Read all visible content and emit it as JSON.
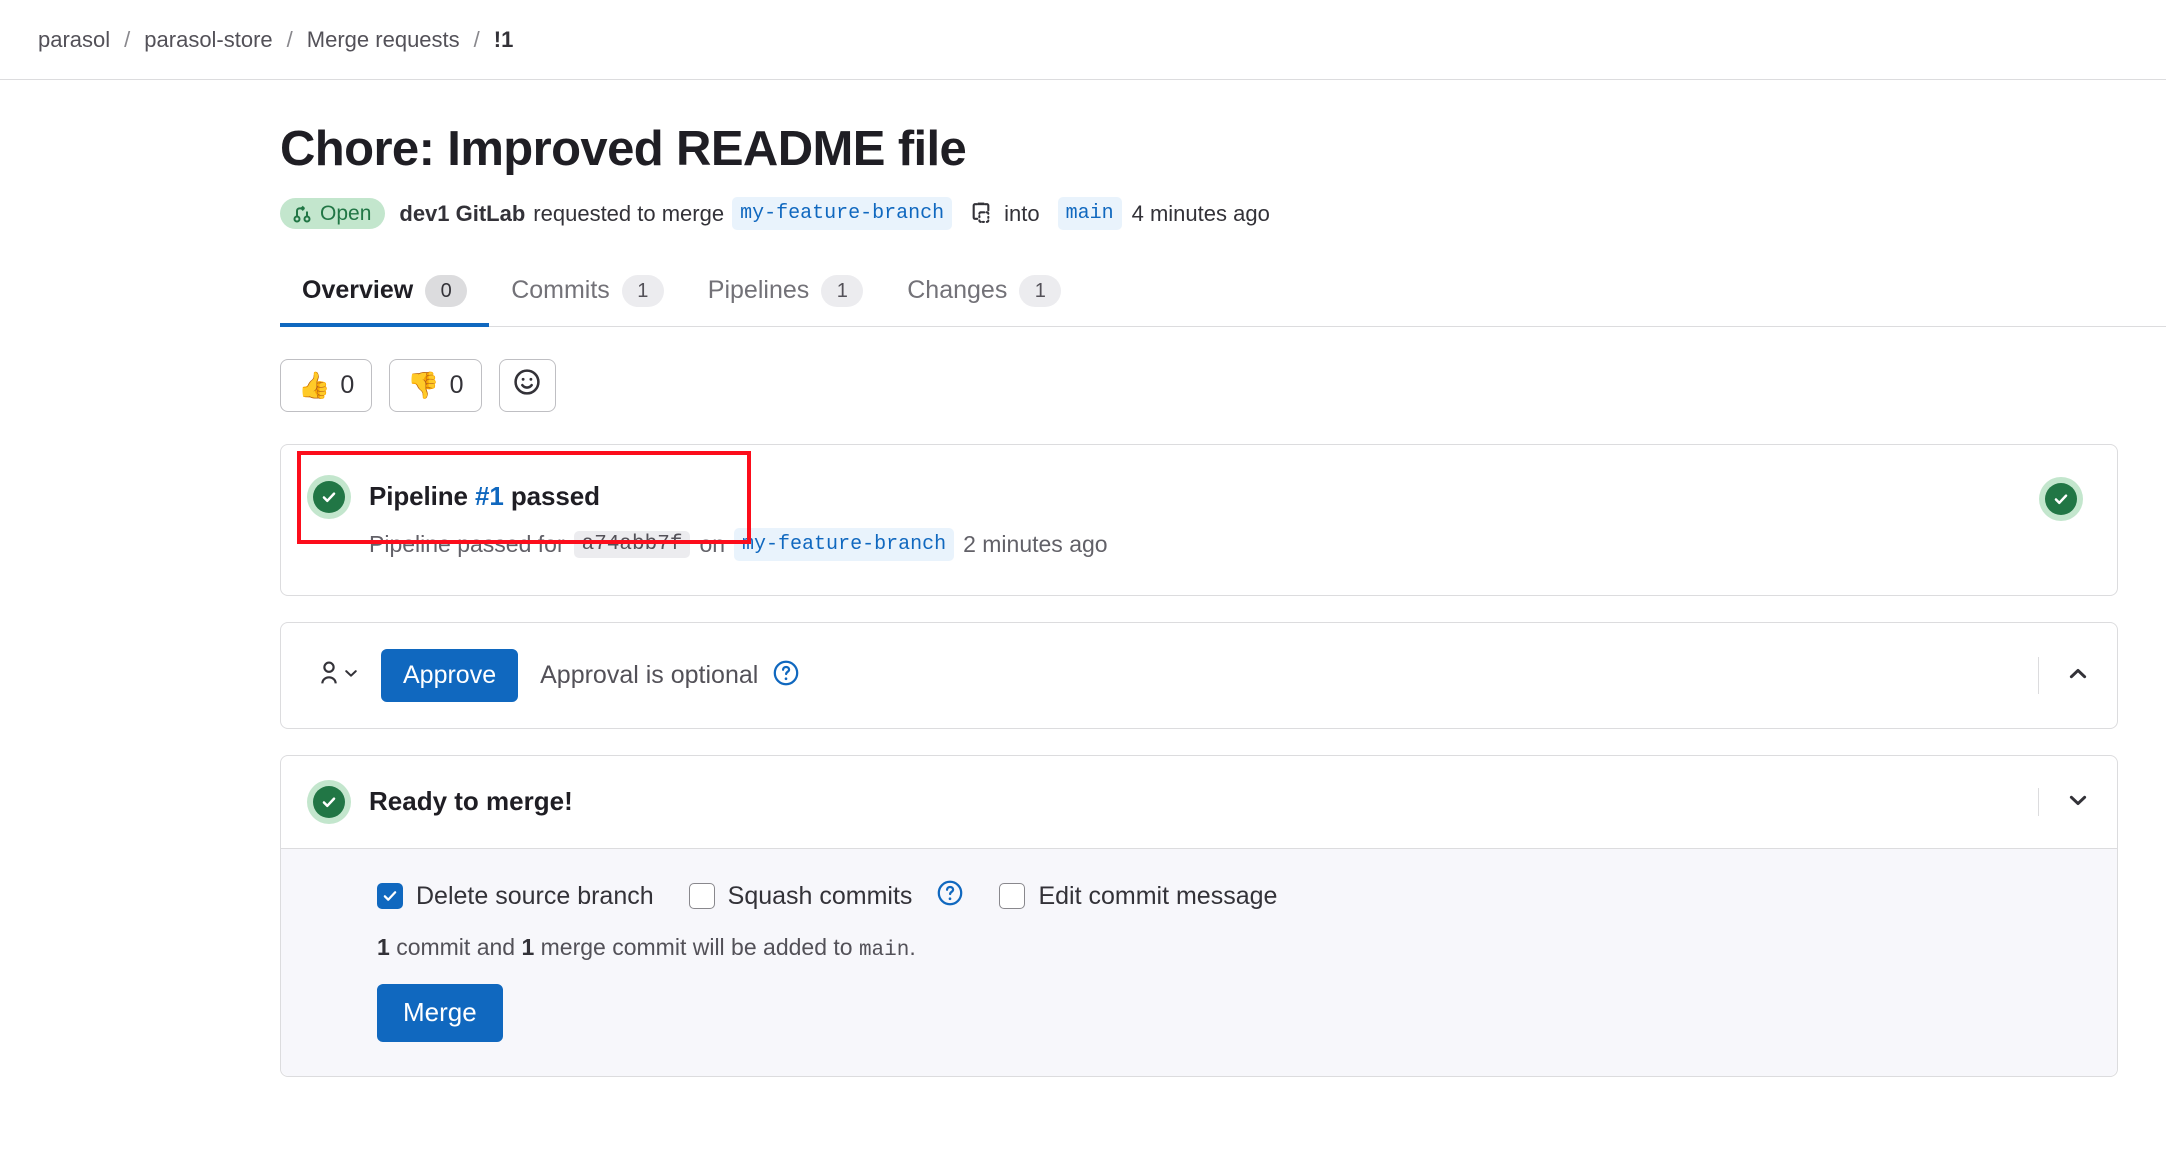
{
  "breadcrumb": {
    "items": [
      {
        "label": "parasol",
        "current": false
      },
      {
        "label": "parasol-store",
        "current": false
      },
      {
        "label": "Merge requests",
        "current": false
      },
      {
        "label": "!1",
        "current": true
      }
    ],
    "separator": "/"
  },
  "merge_request": {
    "title": "Chore: Improved README file",
    "status_badge": "Open",
    "author": "dev1 GitLab",
    "action_text": "requested to merge",
    "source_branch": "my-feature-branch",
    "into_text": "into",
    "target_branch": "main",
    "timestamp": "4 minutes ago"
  },
  "tabs": [
    {
      "label": "Overview",
      "count": "0",
      "active": true
    },
    {
      "label": "Commits",
      "count": "1",
      "active": false
    },
    {
      "label": "Pipelines",
      "count": "1",
      "active": false
    },
    {
      "label": "Changes",
      "count": "1",
      "active": false
    }
  ],
  "reactions": {
    "thumbs_up": {
      "emoji": "👍",
      "count": "0"
    },
    "thumbs_down": {
      "emoji": "👎",
      "count": "0"
    }
  },
  "pipeline": {
    "title_prefix": "Pipeline",
    "number": "#1",
    "title_suffix": "passed",
    "detail_prefix": "Pipeline passed for",
    "commit_sha": "a74abb7f",
    "on_text": "on",
    "branch": "my-feature-branch",
    "timestamp": "2 minutes ago"
  },
  "approval": {
    "button_label": "Approve",
    "status_text": "Approval is optional"
  },
  "merge_widget": {
    "title": "Ready to merge!",
    "checkboxes": [
      {
        "label": "Delete source branch",
        "checked": true,
        "help": false
      },
      {
        "label": "Squash commits",
        "checked": false,
        "help": true
      },
      {
        "label": "Edit commit message",
        "checked": false,
        "help": false
      }
    ],
    "commit_note": {
      "count_commits": "1",
      "text_commit": "commit and",
      "count_merge": "1",
      "text_merge": "merge commit will be added to",
      "target": "main",
      "period": "."
    },
    "merge_button_label": "Merge"
  },
  "colors": {
    "brand_blue": "#1068bf",
    "success_green": "#217645",
    "success_green_light": "#c3e6cd",
    "highlight_red": "#fc0d1b"
  }
}
